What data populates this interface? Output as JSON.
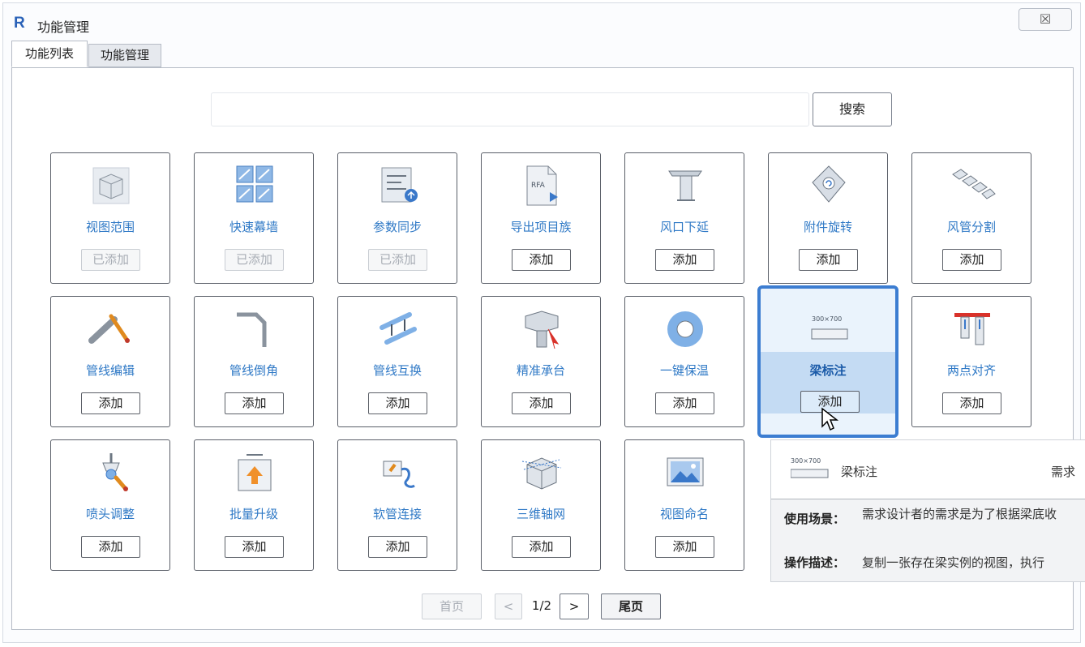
{
  "window": {
    "app_logo": "R",
    "title": "功能管理",
    "close_label": "☒"
  },
  "tabs": [
    {
      "label": "功能列表",
      "active": true
    },
    {
      "label": "功能管理",
      "active": false
    }
  ],
  "search": {
    "value": "",
    "button_label": "搜索"
  },
  "cards": [
    {
      "label": "视图范围",
      "button": "已添加",
      "icon": "view-range-icon"
    },
    {
      "label": "快速幕墙",
      "button": "已添加",
      "icon": "curtain-wall-icon"
    },
    {
      "label": "参数同步",
      "button": "已添加",
      "icon": "param-sync-icon"
    },
    {
      "label": "导出项目族",
      "button": "添加",
      "icon": "rfa-export-icon"
    },
    {
      "label": "风口下延",
      "button": "添加",
      "icon": "air-vent-extend-icon"
    },
    {
      "label": "附件旋转",
      "button": "添加",
      "icon": "fitting-rotate-icon"
    },
    {
      "label": "风管分割",
      "button": "添加",
      "icon": "duct-split-icon"
    },
    {
      "label": "管线编辑",
      "button": "添加",
      "icon": "pipe-edit-icon"
    },
    {
      "label": "管线倒角",
      "button": "添加",
      "icon": "pipe-chamfer-icon"
    },
    {
      "label": "管线互换",
      "button": "添加",
      "icon": "pipe-swap-icon"
    },
    {
      "label": "精准承台",
      "button": "添加",
      "icon": "pile-cap-icon"
    },
    {
      "label": "一键保温",
      "button": "添加",
      "icon": "insulation-icon"
    },
    {
      "label": "梁标注",
      "button": "添加",
      "icon": "beam-tag-icon"
    },
    {
      "label": "两点对齐",
      "button": "添加",
      "icon": "two-point-align-icon"
    },
    {
      "label": "喷头调整",
      "button": "添加",
      "icon": "sprinkler-adjust-icon"
    },
    {
      "label": "批量升级",
      "button": "添加",
      "icon": "batch-upgrade-icon"
    },
    {
      "label": "软管连接",
      "button": "添加",
      "icon": "flex-pipe-icon"
    },
    {
      "label": "三维轴网",
      "button": "添加",
      "icon": "3d-grid-icon"
    },
    {
      "label": "视图命名",
      "button": "添加",
      "icon": "view-naming-icon"
    }
  ],
  "tooltip": {
    "thumb_text": "300×700",
    "title": "梁标注",
    "right_text": "需求",
    "scenario_label": "使用场景：",
    "scenario_text": "需求设计者的需求是为了根据梁底收",
    "operation_label": "操作描述：",
    "operation_text": "复制一张存在梁实例的视图，执行"
  },
  "pagination": {
    "first": "首页",
    "prev": "<",
    "info": "1/2",
    "next": ">",
    "last": "尾页"
  },
  "colors": {
    "accent": "#3c7dd1",
    "label_blue": "#2f79c6"
  }
}
